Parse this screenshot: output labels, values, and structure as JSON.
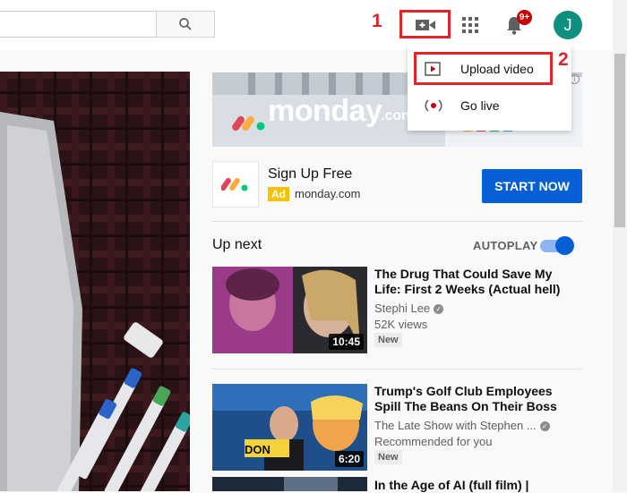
{
  "header": {
    "search_icon": "search-icon",
    "create_icon": "video-camera-plus-icon",
    "apps_icon": "apps-grid-icon",
    "bell_icon": "bell-icon",
    "notification_count": "9+",
    "avatar_letter": "J"
  },
  "annotations": {
    "step1": "1",
    "step2": "2"
  },
  "create_menu": {
    "items": [
      {
        "label": "Upload video",
        "icon": "upload-video-icon"
      },
      {
        "label": "Go live",
        "icon": "go-live-icon"
      }
    ]
  },
  "ad": {
    "banner_text": "monday",
    "banner_suffix": ".com",
    "title": "Sign Up Free",
    "tag": "Ad",
    "domain": "monday.com",
    "cta": "START NOW"
  },
  "up_next": {
    "label": "Up next",
    "autoplay_label": "AUTOPLAY",
    "autoplay_on": true
  },
  "videos": [
    {
      "title": "The Drug That Could Save My Life: First 2 Weeks (Actual hell)",
      "channel": "Stephi Lee",
      "meta": "52K views",
      "badge": "New",
      "duration": "10:45"
    },
    {
      "title": "Trump's Golf Club Employees Spill The Beans On Their Boss",
      "channel": "The Late Show with Stephen ...",
      "meta": "Recommended for you",
      "badge": "New",
      "duration": "6:20"
    },
    {
      "title": "In the Age of AI (full film) |",
      "channel": "",
      "meta": "",
      "badge": "",
      "duration": ""
    }
  ],
  "colors": {
    "accent": "#065fd4",
    "annotation": "#e0262b",
    "badge": "#cc0000",
    "avatar": "#0f8f7f"
  }
}
